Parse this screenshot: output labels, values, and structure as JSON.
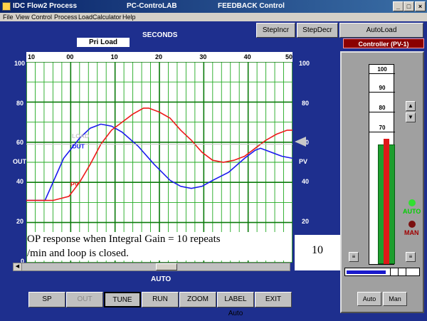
{
  "window": {
    "app_title": "IDC Flow2 Process",
    "center_title": "PC-ControLAB",
    "right_title": "FEEDBACK Control",
    "min_label": "_",
    "max_label": "□",
    "close_label": "×"
  },
  "menu": [
    "File",
    "View",
    "Control",
    "Process",
    "Load",
    "Calculator",
    "Help"
  ],
  "toolbar": {
    "seconds_label": "SECONDS",
    "step_incr": "StepIncr",
    "step_decr": "StepDecr",
    "auto_load": "AutoLoad",
    "pri_load": "Pri Load"
  },
  "controller": {
    "title": "Controller  (PV-1)",
    "scale": [
      "100",
      "90",
      "80",
      "70"
    ],
    "pv_percent": 60,
    "sp_percent": 63,
    "mode_auto": "AUTO",
    "mode_man": "MAN",
    "auto_button": "Auto",
    "man_button": "Man",
    "output_percent": 55,
    "colors": {
      "pv_bar": "#1e9e2e",
      "sp_bar": "#e01818",
      "auto_led": "#30e030",
      "man_led": "#7a1010"
    }
  },
  "axis": {
    "left_ticks": [
      "100",
      "80",
      "60",
      "40",
      "20",
      "0"
    ],
    "right_ticks": [
      "100",
      "80",
      "60",
      "40",
      "20"
    ],
    "left_label": "OUT",
    "right_label": "PV",
    "top_ticks": [
      "10",
      "00",
      "10",
      "20",
      "30",
      "40",
      "50"
    ]
  },
  "chart_data": {
    "type": "line",
    "x_ticks": [
      "10",
      "00",
      "10",
      "20",
      "30",
      "40",
      "50"
    ],
    "ylim": [
      0,
      100
    ],
    "grid": true,
    "inline_labels": [
      "LOAD",
      "OUT",
      "PV"
    ],
    "series": [
      {
        "name": "OUT",
        "color": "#1a1aee",
        "points": [
          [
            0,
            31
          ],
          [
            4,
            31
          ],
          [
            7,
            31
          ],
          [
            9,
            37
          ],
          [
            14,
            52
          ],
          [
            20,
            62
          ],
          [
            24,
            67
          ],
          [
            28,
            69
          ],
          [
            32,
            68
          ],
          [
            36,
            65
          ],
          [
            42,
            58
          ],
          [
            48,
            49
          ],
          [
            54,
            41
          ],
          [
            58,
            38
          ],
          [
            62,
            37
          ],
          [
            66,
            38
          ],
          [
            70,
            41
          ],
          [
            76,
            45
          ],
          [
            82,
            52
          ],
          [
            86,
            56
          ],
          [
            88,
            57
          ],
          [
            92,
            55
          ],
          [
            96,
            53
          ],
          [
            100,
            52
          ]
        ]
      },
      {
        "name": "PV",
        "color": "#ee1a1a",
        "points": [
          [
            0,
            31
          ],
          [
            10,
            31
          ],
          [
            16,
            33
          ],
          [
            20,
            40
          ],
          [
            24,
            49
          ],
          [
            28,
            59
          ],
          [
            32,
            66
          ],
          [
            36,
            70
          ],
          [
            40,
            74
          ],
          [
            44,
            77
          ],
          [
            46,
            77
          ],
          [
            50,
            75
          ],
          [
            54,
            72
          ],
          [
            58,
            66
          ],
          [
            62,
            61
          ],
          [
            66,
            55
          ],
          [
            70,
            51
          ],
          [
            74,
            50
          ],
          [
            78,
            51
          ],
          [
            82,
            53
          ],
          [
            86,
            57
          ],
          [
            90,
            61
          ],
          [
            94,
            64
          ],
          [
            98,
            66
          ],
          [
            100,
            66
          ]
        ]
      },
      {
        "name": "LOAD",
        "color": "#c8c8c8",
        "points": [
          [
            0,
            59
          ],
          [
            100,
            59
          ]
        ]
      }
    ]
  },
  "caption": {
    "line1": "OP response when Integral Gain = 10 repeats",
    "line2": "/min and loop is closed.",
    "value": "10"
  },
  "status": {
    "auto_label": "AUTO"
  },
  "buttons": [
    "SP",
    "OUT",
    "TUNE",
    "RUN",
    "ZOOM",
    "LABEL Auto",
    "EXIT"
  ]
}
